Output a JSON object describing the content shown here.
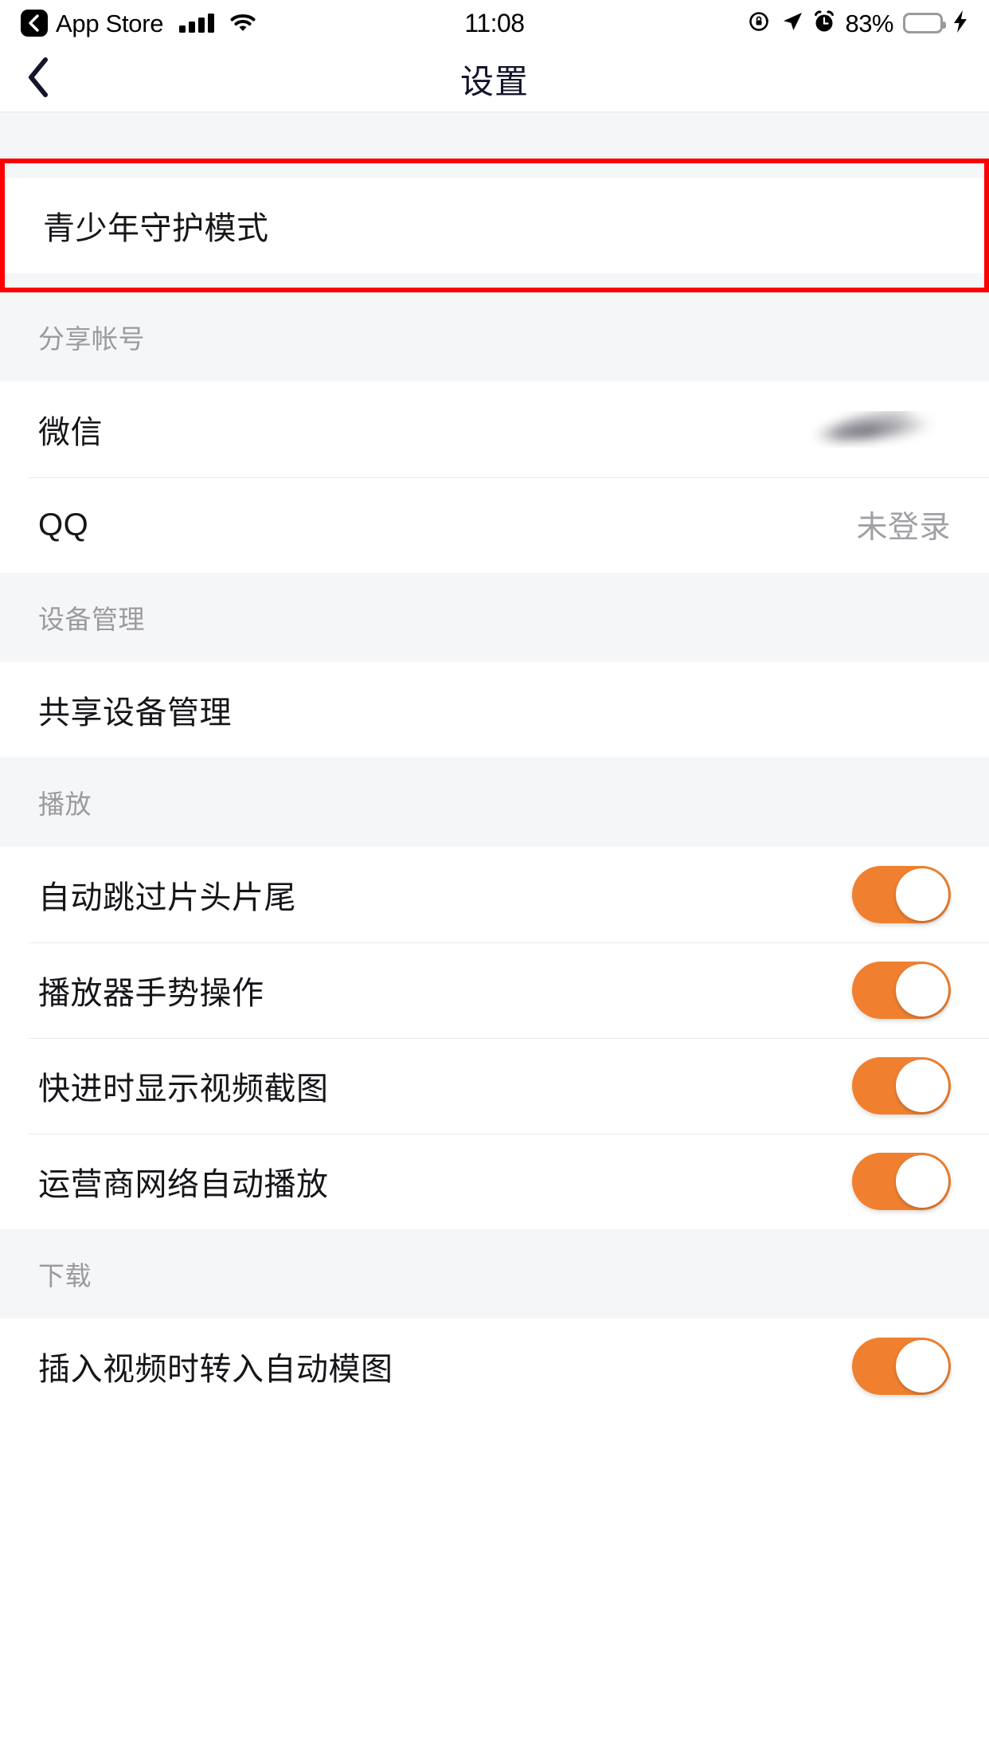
{
  "status_bar": {
    "back_app_label": "App Store",
    "time": "11:08",
    "battery_percent": "83%",
    "icons": {
      "back_badge": "chevron-left-badge-icon",
      "signal": "cellular-signal-icon",
      "wifi": "wifi-icon",
      "rotation_lock": "rotation-lock-icon",
      "location": "location-arrow-icon",
      "alarm": "alarm-clock-icon",
      "battery": "battery-icon",
      "charging": "lightning-bolt-icon"
    },
    "battery_color": "#4cd964"
  },
  "nav": {
    "title": "设置",
    "back_icon": "chevron-left-icon"
  },
  "colors": {
    "accent_toggle_on": "#f0802f",
    "highlight_border": "#ff0000",
    "page_background": "#f5f6f8",
    "row_background": "#ffffff",
    "section_label": "#9a9a9f"
  },
  "sections": [
    {
      "header": "",
      "highlighted": true,
      "rows": [
        {
          "label": "青少年守护模式",
          "type": "link",
          "value": ""
        }
      ]
    },
    {
      "header": "分享帐号",
      "highlighted": false,
      "rows": [
        {
          "label": "微信",
          "type": "value-blurred",
          "value": ""
        },
        {
          "label": "QQ",
          "type": "value",
          "value": "未登录"
        }
      ]
    },
    {
      "header": "设备管理",
      "highlighted": false,
      "rows": [
        {
          "label": "共享设备管理",
          "type": "link",
          "value": ""
        }
      ]
    },
    {
      "header": "播放",
      "highlighted": false,
      "rows": [
        {
          "label": "自动跳过片头片尾",
          "type": "toggle",
          "toggle_on": true
        },
        {
          "label": "播放器手势操作",
          "type": "toggle",
          "toggle_on": true
        },
        {
          "label": "快进时显示视频截图",
          "type": "toggle",
          "toggle_on": true
        },
        {
          "label": "运营商网络自动播放",
          "type": "toggle",
          "toggle_on": true
        }
      ]
    },
    {
      "header": "下载",
      "highlighted": false,
      "rows": [
        {
          "label": "插入视频时转入自动模图",
          "type": "toggle",
          "toggle_on": true
        }
      ]
    }
  ]
}
